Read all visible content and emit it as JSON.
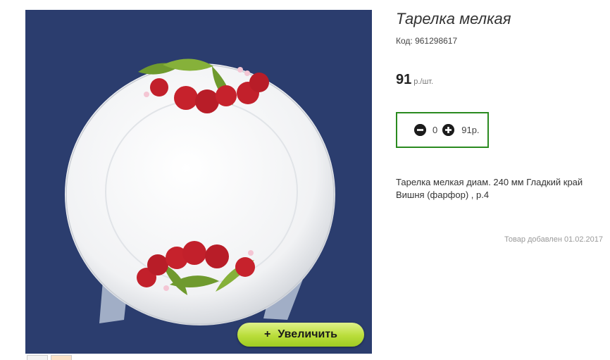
{
  "product": {
    "title": "Тарелка мелкая",
    "code": "Код: 961298617",
    "price_value": "91",
    "price_unit": "р./шт.",
    "quantity": "0",
    "total": "91р.",
    "description": "Тарелка мелкая диам. 240 мм Гладкий край Вишня (фарфор) , р.4",
    "added": "Товар добавлен 01.02.2017"
  },
  "image": {
    "zoom_label": "Увеличить",
    "zoom_icon": "+"
  },
  "icons": {
    "minus": "minus-circle-icon",
    "plus": "plus-circle-icon"
  },
  "colors": {
    "photo_background": "#2b3d6e",
    "qty_border": "#2a8a1f",
    "zoom_button": "#b9dd3a"
  }
}
